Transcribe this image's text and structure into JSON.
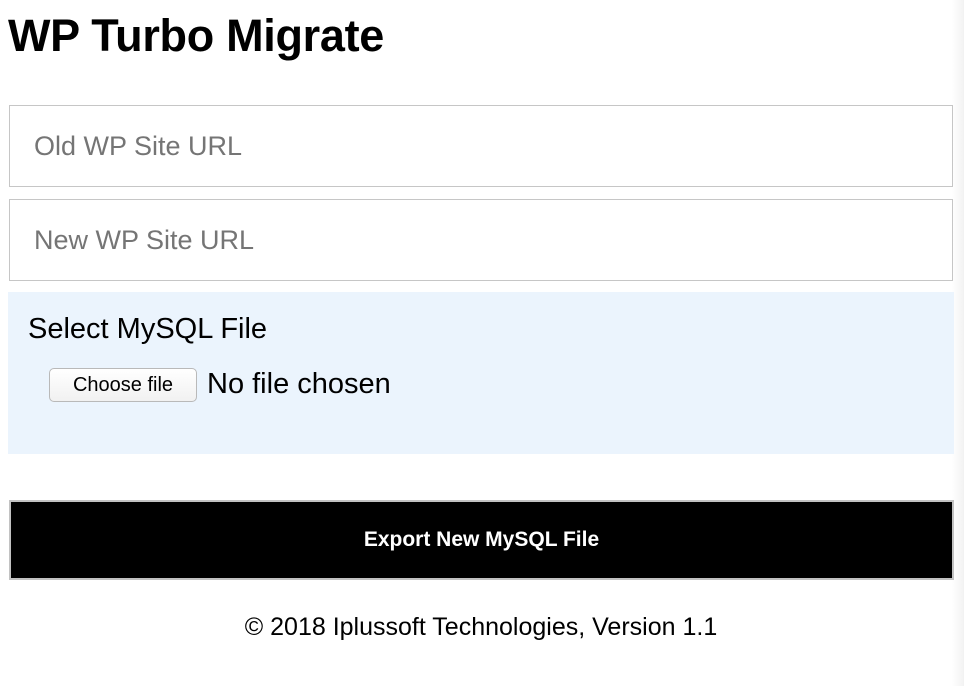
{
  "header": {
    "title": "WP Turbo Migrate"
  },
  "form": {
    "old_url": {
      "placeholder": "Old WP Site URL",
      "value": ""
    },
    "new_url": {
      "placeholder": "New WP Site URL",
      "value": ""
    },
    "file_select": {
      "label": "Select MySQL File",
      "button_label": "Choose file",
      "status": "No file chosen"
    },
    "export_button_label": "Export New MySQL File"
  },
  "footer": {
    "text": "© 2018 Iplussoft Technologies, Version 1.1"
  },
  "colors": {
    "file_panel_background": "#ebf4fd",
    "export_button_background": "#000000",
    "export_button_text": "#ffffff",
    "input_border": "#c6c6c6"
  }
}
